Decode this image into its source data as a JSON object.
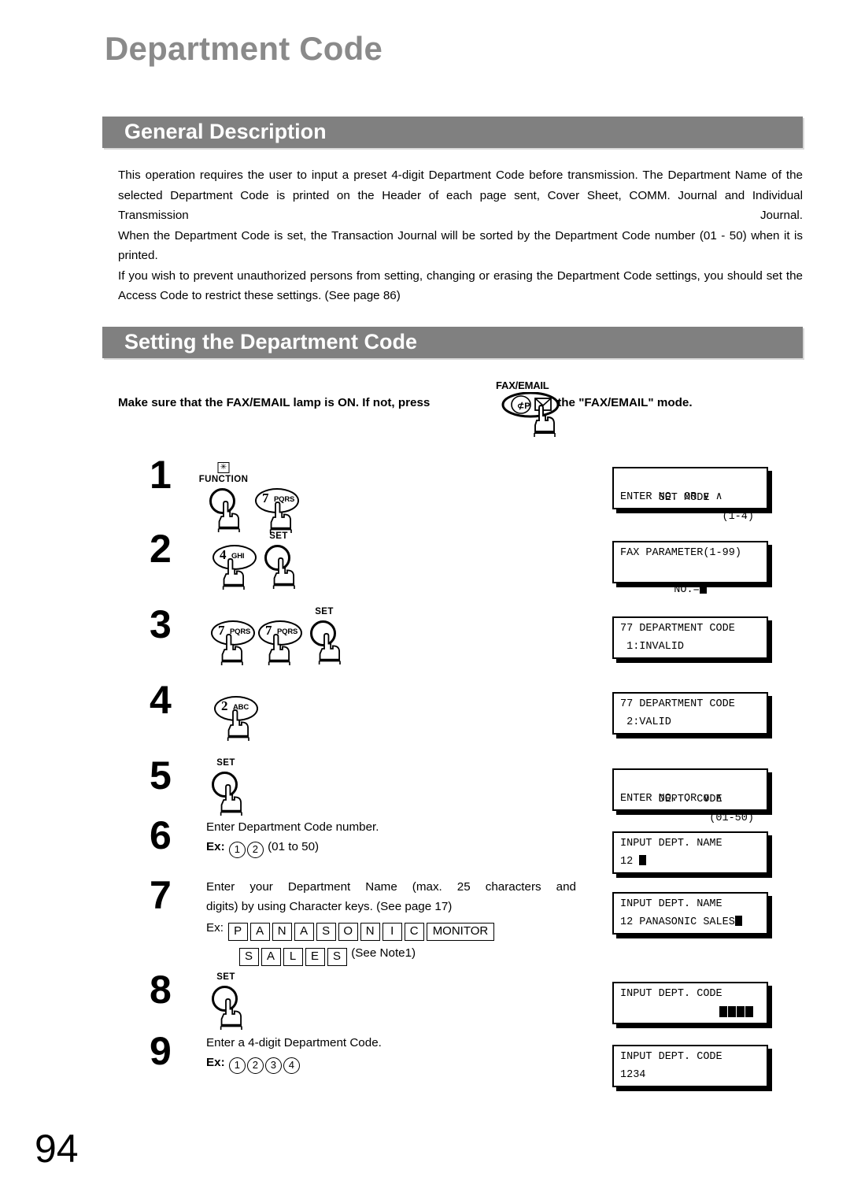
{
  "document": {
    "title": "Department Code",
    "page_number": "94"
  },
  "sections": {
    "general": {
      "heading": "General Description",
      "paragraphs": [
        "This operation requires the user to input a preset 4-digit Department Code before transmission.  The Department Name of the selected Department Code is printed on the Header of each page sent, Cover Sheet, COMM. Journal and Individual Transmission Journal.",
        "When the Department Code is set, the Transaction Journal will be sorted by the Department Code number (01 - 50) when it is printed.",
        "If you wish to prevent unauthorized persons from setting, changing or erasing the Department Code settings, you should set the Access Code to restrict these settings. (See page 86)"
      ]
    },
    "setting": {
      "heading": "Setting the Department Code",
      "lamp_note_before": "Make sure that the FAX/EMAIL lamp is ON.  If not, press",
      "lamp_note_after": "to select the \"FAX/EMAIL\" mode.",
      "fax_email_label": "FAX/EMAIL"
    }
  },
  "steps": [
    {
      "number": "1",
      "keys": [
        {
          "type": "round",
          "cap": "FUNCTION",
          "star": "✻"
        },
        {
          "type": "oval",
          "num": "7",
          "sub": "PQRS"
        }
      ],
      "lcd": {
        "line1_left": "SET MODE",
        "line1_right": "(1-4)",
        "line2_left": "ENTER NO. OR ∨ ∧"
      }
    },
    {
      "number": "2",
      "keys": [
        {
          "type": "oval",
          "num": "4",
          "sub": "GHI"
        },
        {
          "type": "round",
          "cap": "SET"
        }
      ],
      "lcd": {
        "line1_left": "FAX PARAMETER(1-99)",
        "line2_center": "NO.="
      }
    },
    {
      "number": "3",
      "keys": [
        {
          "type": "oval",
          "num": "7",
          "sub": "PQRS"
        },
        {
          "type": "oval",
          "num": "7",
          "sub": "PQRS"
        },
        {
          "type": "round",
          "cap": "SET"
        }
      ],
      "lcd": {
        "line1_left": "77 DEPARTMENT CODE",
        "line2_left": " 1:INVALID"
      }
    },
    {
      "number": "4",
      "keys": [
        {
          "type": "oval",
          "num": "2",
          "sub": "ABC"
        }
      ],
      "lcd": {
        "line1_left": "77 DEPARTMENT CODE",
        "line2_left": " 2:VALID"
      }
    },
    {
      "number": "5",
      "keys": [
        {
          "type": "round",
          "cap": "SET"
        }
      ],
      "lcd": {
        "line1_left": "DEPT. CODE",
        "line1_right": "(01-50)",
        "line2_left": "ENTER NO. OR ∨ ∧"
      }
    },
    {
      "number": "6",
      "text_lines": [
        "Enter Department Code number."
      ],
      "example_label": "Ex:",
      "example_digits": [
        "1",
        "2"
      ],
      "example_suffix": "(01 to 50)",
      "lcd": {
        "line1_left": "INPUT DEPT. NAME",
        "line2_left": "12 "
      }
    },
    {
      "number": "7",
      "text_lines": [
        "Enter your Department Name (max. 25 characters and",
        "digits) by using Character keys. (See page 17)"
      ],
      "example_label": "Ex:",
      "example_keys_row1": [
        "P",
        "A",
        "N",
        "A",
        "S",
        "O",
        "N",
        "I",
        "C",
        "MONITOR"
      ],
      "example_keys_row2": [
        "S",
        "A",
        "L",
        "E",
        "S"
      ],
      "example_note": "(See Note1)",
      "lcd": {
        "line1_left": "INPUT DEPT. NAME",
        "line2_left": "12 PANASONIC SALES"
      }
    },
    {
      "number": "8",
      "keys": [
        {
          "type": "round",
          "cap": "SET"
        }
      ],
      "lcd": {
        "line1_left": "INPUT DEPT. CODE",
        "line2_right_blocks": "4"
      }
    },
    {
      "number": "9",
      "text_lines": [
        "Enter a 4-digit Department Code."
      ],
      "example_label": "Ex:",
      "example_digits": [
        "1",
        "2",
        "3",
        "4"
      ],
      "lcd": {
        "line1_left": "INPUT DEPT. CODE",
        "line2_left": "1234"
      }
    }
  ],
  "colors": {
    "bar_gray": "#808080",
    "title_gray": "#8a8a8a",
    "text_black": "#000000"
  }
}
